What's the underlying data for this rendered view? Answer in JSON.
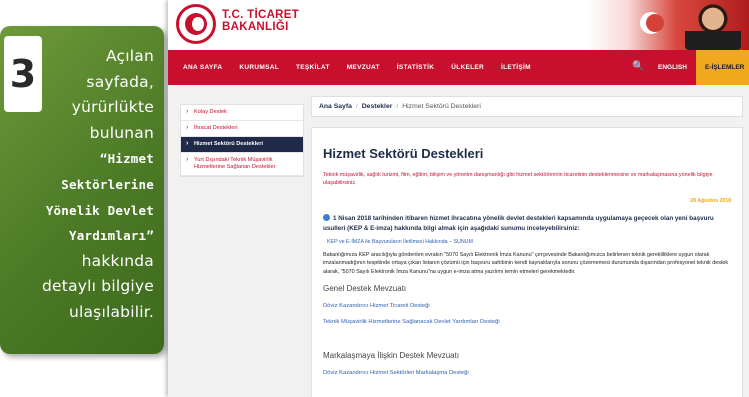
{
  "instruction": {
    "step": "3",
    "text_before": "Açılan sayfada, yürürlükte bulunan ",
    "highlight": "“Hizmet Sektörlerine Yönelik Devlet Yardımları”",
    "text_after": " hakkında detaylı bilgiye ulaşılabilir."
  },
  "site": {
    "brand_line1": "T.C. TİCARET",
    "brand_line2": "BAKANLIĞI",
    "nav": [
      "ANA SAYFA",
      "KURUMSAL",
      "TEŞKİLAT",
      "MEVZUAT",
      "İSTATİSTİK",
      "ÜLKELER",
      "İLETİŞİM"
    ],
    "search_glyph": "🔍",
    "lang": "ENGLISH",
    "eislemler": "E-İŞLEMLER",
    "sidebar": [
      "Kolay Destek",
      "İhracat Destekleri",
      "Hizmet Sektörü Destekleri",
      "Yurt Dışındaki Teknik Müşavirlik Hizmetlerine Sağlanan Destekler"
    ],
    "breadcrumb": {
      "home": "Ana Sayfa",
      "section": "Destekler",
      "current": "Hizmet Sektörü Destekleri"
    },
    "content": {
      "title": "Hizmet Sektörü Destekleri",
      "intro": "Teknik müşavirlik, sağlık turizmi, film, eğitim, bilişim ve yönetim danışmanlığı gibi hizmet sektörlerinin ticaretinin desteklenmesine ve markalaşmasına yönelik bilgiye ulaşabilirsiniz.",
      "date": "28 Ağustos 2018",
      "notice": "1 Nisan 2018 tarihinden itibaren hizmet ihracatına yönelik devlet destekleri kapsamında uygulamaya geçecek olan yeni başvuru usulleri (KEP & E-imza) hakkında bilgi almak için aşağıdaki sunumu inceleyebilirsiniz:",
      "sunum_link": "KEP ve E-İMZA ile Başvuruların İletilmesi Hakkında – SUNUM",
      "body": "Bakanlığımıza KEP aracılığıyla gönderilen evrakın \"5070 Sayılı Elektronik İmza Kanunu\" çerçevesinde Bakanlığımızca belirlenen teknik gerekliliklere uygun olarak imzalanmadığının tespitinde ortaya çıkan listanın çözümü için başvuru sahibinin kendi kaynaklarıyla sorunu çözememesi durumunda dışarından profesyonel teknik destek alarak, \"5070 Sayılı Elektronik İmza Kanunu\"na uygun e-imza atma yazılımı temin etmeleri gerekmektedir.",
      "heading1": "Genel Destek Mevzuatı",
      "link1": "Döviz Kazandırıcı Hizmet Ticareti Desteği",
      "link2": "Teknik Müşavirlik Hizmetlerine Sağlanacak Devlet Yardımları Desteği",
      "heading2": "Markalaşmaya İlişkin Destek Mevzuatı",
      "link3": "Döviz Kazandırıcı Hizmet Sektörleri Markalaşma Desteği"
    }
  },
  "colors": {
    "card_green": "#4c7a26",
    "brand_red": "#c8102e",
    "accent_orange": "#f0a81c",
    "navy": "#1f2b49",
    "link_blue": "#3060b0"
  }
}
